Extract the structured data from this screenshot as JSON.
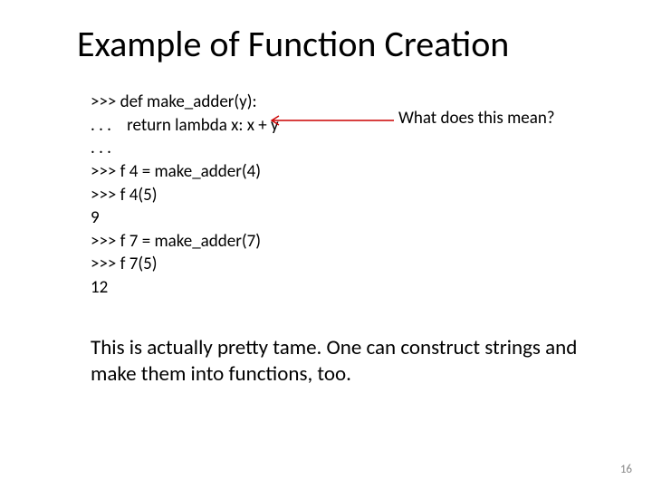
{
  "title": "Example of Function Creation",
  "code": {
    "l1": ">>> def make_adder(y):",
    "l2": ". . .    return lambda x: x + y",
    "l3": ". . .",
    "l4": ">>> f 4 = make_adder(4)",
    "l5": ">>> f 4(5)",
    "l6": "9",
    "l7": ">>> f 7 = make_adder(7)",
    "l8": ">>> f 7(5)",
    "l9": "12"
  },
  "annotation": "What does this mean?",
  "body": "This is actually pretty tame.  One can construct strings and make them into functions, too.",
  "page_number": "16",
  "colors": {
    "arrow": "#cc0000"
  }
}
